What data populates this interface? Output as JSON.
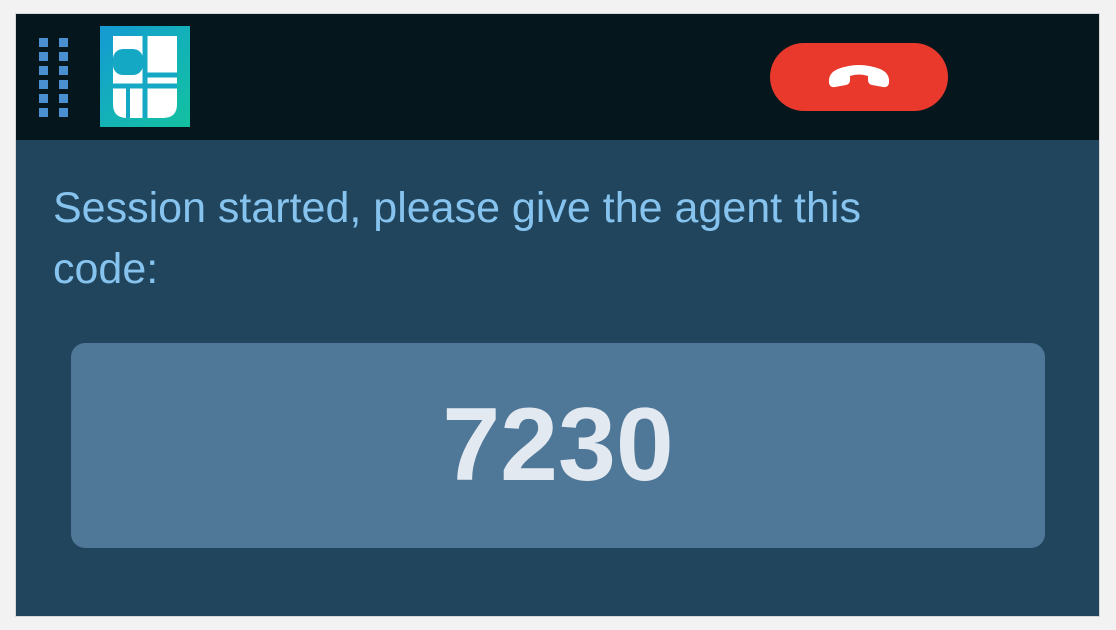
{
  "window": {
    "drag_handle_icon": "grip-dots-icon",
    "app_logo_icon": "app-logo-icon",
    "end_call_icon": "phone-hangup-icon"
  },
  "session": {
    "message": "Session started, please give the agent this code:",
    "code": "7230"
  },
  "colors": {
    "titlebar": "#05161c",
    "background": "#21455c",
    "message_text": "#86c3ee",
    "code_box": "#4f7798",
    "code_text": "#e3e9f0",
    "end_call": "#e8392c",
    "grip": "#4a90d0"
  }
}
